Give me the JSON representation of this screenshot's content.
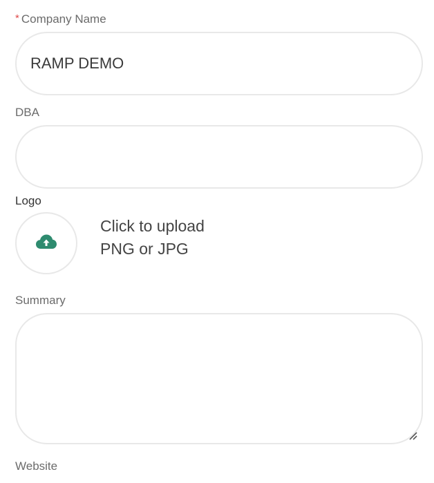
{
  "company_name": {
    "required_marker": "*",
    "label": "Company Name",
    "value": "RAMP DEMO",
    "placeholder": ""
  },
  "dba": {
    "label": "DBA",
    "value": "",
    "placeholder": ""
  },
  "logo": {
    "label": "Logo",
    "icon": "cloud-upload-icon",
    "upload_title": "Click to upload",
    "upload_hint": "PNG or JPG"
  },
  "summary": {
    "label": "Summary",
    "value": "",
    "placeholder": ""
  },
  "website": {
    "label": "Website"
  },
  "colors": {
    "accent": "#2e8b6f",
    "required": "#e04b4b",
    "border": "#e8e8e8",
    "label": "#6b6b6b"
  }
}
